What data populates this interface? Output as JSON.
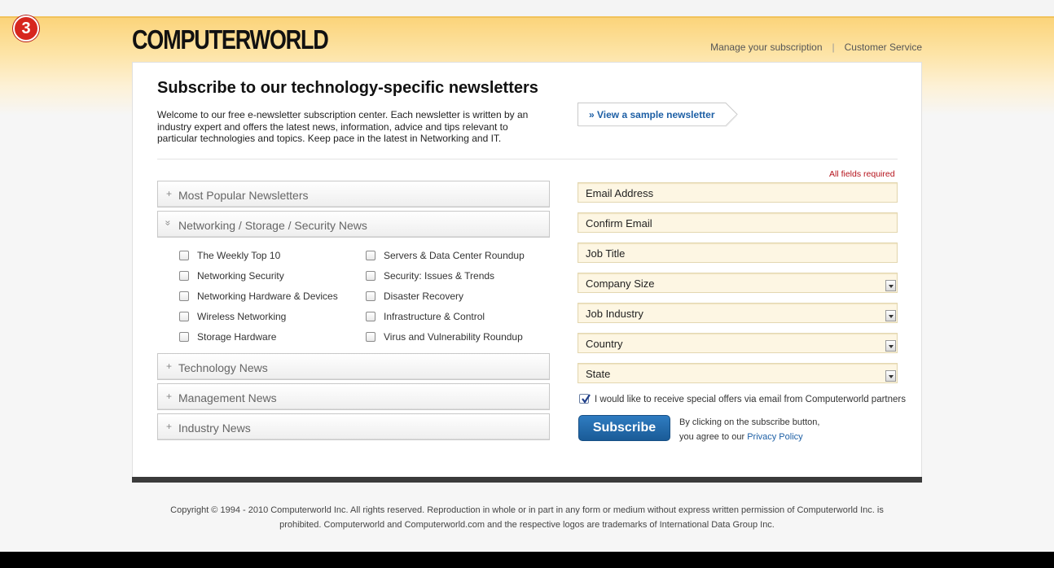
{
  "step_badge": "3",
  "brand": {
    "logo_text": "COMPUTERWORLD"
  },
  "top_nav": {
    "manage": "Manage your subscription",
    "separator": "|",
    "service": "Customer Service"
  },
  "main": {
    "title": "Subscribe to our technology-specific newsletters",
    "intro": "Welcome to our free e-newsletter subscription center. Each newsletter is written by an industry expert and offers the latest news, information, advice and tips relevant to particular technologies and topics. Keep pace in the latest in Networking and IT.",
    "sample_link": "» View a sample newsletter"
  },
  "categories": [
    {
      "label": "Most Popular Newsletters",
      "symbol": "+",
      "expanded": false
    },
    {
      "label": "Networking / Storage / Security News",
      "symbol": "»",
      "expanded": true
    },
    {
      "label": "Technology News",
      "symbol": "+",
      "expanded": false
    },
    {
      "label": "Management News",
      "symbol": "+",
      "expanded": false
    },
    {
      "label": "Industry News",
      "symbol": "+",
      "expanded": false
    }
  ],
  "newsletters": {
    "left": [
      {
        "label": "The Weekly Top 10",
        "checked": false
      },
      {
        "label": "Networking Security",
        "checked": false
      },
      {
        "label": "Networking Hardware & Devices",
        "checked": false
      },
      {
        "label": "Wireless Networking",
        "checked": false
      },
      {
        "label": "Storage Hardware",
        "checked": false
      }
    ],
    "right": [
      {
        "label": "Servers & Data Center Roundup",
        "checked": false
      },
      {
        "label": "Security: Issues & Trends",
        "checked": false
      },
      {
        "label": "Disaster Recovery",
        "checked": false
      },
      {
        "label": "Infrastructure & Control",
        "checked": false
      },
      {
        "label": "Virus and Vulnerability Roundup",
        "checked": false
      }
    ]
  },
  "form": {
    "required_note": "All fields required",
    "fields": [
      {
        "placeholder": "Email Address",
        "type": "text",
        "value": ""
      },
      {
        "placeholder": "Confirm Email",
        "type": "text",
        "value": ""
      },
      {
        "placeholder": "Job Title",
        "type": "text",
        "value": ""
      },
      {
        "placeholder": "Company Size",
        "type": "select",
        "value": ""
      },
      {
        "placeholder": "Job Industry",
        "type": "select",
        "value": ""
      },
      {
        "placeholder": "Country",
        "type": "select",
        "value": ""
      },
      {
        "placeholder": "State",
        "type": "select",
        "value": ""
      }
    ],
    "optin_label": "I would like to receive special offers via email from Computerworld partners",
    "optin_checked": true,
    "subscribe_label": "Subscribe",
    "note_line1": "By clicking on the subscribe button,",
    "note_line2": "you agree to our",
    "privacy_link": "Privacy Policy"
  },
  "footer": {
    "line1": "Copyright © 1994 - 2010 Computerworld Inc. All rights reserved. Reproduction in whole or in part in any form or medium without express written permission of Computerworld Inc. is",
    "line2": "prohibited. Computerworld and Computerworld.com and the respective logos are trademarks of International Data Group Inc."
  },
  "colors": {
    "header_gold": "#fbd47a",
    "field_bg": "#fdf6e3",
    "accent_blue": "#1d5fa5",
    "required_red": "#b5121b",
    "badge_red": "#d7261e"
  }
}
